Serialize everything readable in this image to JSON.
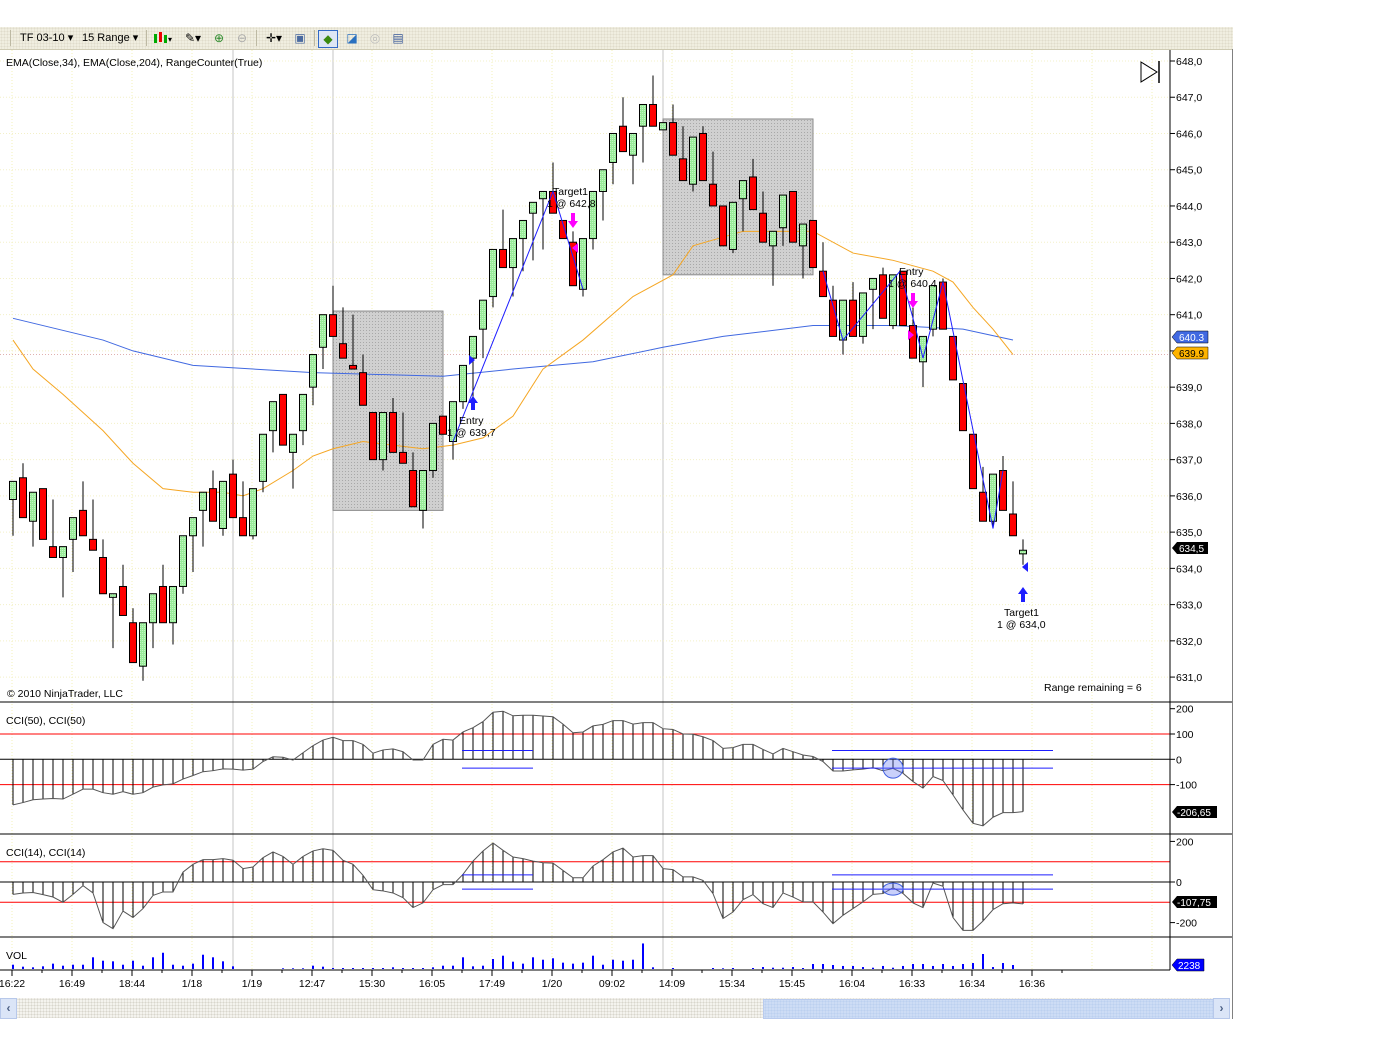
{
  "toolbar": {
    "instrument": "TF 03-10",
    "period": "15 Range",
    "icons": [
      "candlestick-style-icon",
      "pencil-draw-icon",
      "zoom-in-icon",
      "zoom-out-icon",
      "crosshair-icon",
      "properties-icon",
      "strategy-icon",
      "indicators-icon",
      "disabled-icon",
      "data-box-icon"
    ]
  },
  "chart": {
    "indicator_label": "EMA(Close,34), EMA(Close,204), RangeCounter(True)",
    "copyright": "© 2010 NinjaTrader, LLC",
    "range_remaining": "Range remaining = 6",
    "price_axis": [
      "648,0",
      "647,0",
      "646,0",
      "645,0",
      "644,0",
      "643,0",
      "642,0",
      "641,0",
      "640,0",
      "639,0",
      "638,0",
      "637,0",
      "636,0",
      "635,0",
      "634,0",
      "633,0",
      "632,0",
      "631,0"
    ],
    "last_price_tag": "634,5",
    "ema204_tag": "640.3",
    "ema34_tag": "639.9",
    "time_axis": [
      "16:22",
      "16:49",
      "18:44",
      "1/18",
      "1/19",
      "12:47",
      "15:30",
      "16:05",
      "17:49",
      "1/20",
      "09:02",
      "14:09",
      "15:34",
      "15:45",
      "16:04",
      "16:33",
      "16:34",
      "16:36"
    ],
    "annotations": {
      "entry1": [
        "Entry",
        "1 @ 639,7"
      ],
      "target1": [
        "Target1",
        "1 @ 642,8"
      ],
      "entry2": [
        "Entry",
        "1 @ 640,4"
      ],
      "target2": [
        "Target1",
        "1 @ 634,0"
      ]
    },
    "cci50_label": "CCI(50), CCI(50)",
    "cci50_axis": [
      "200",
      "100",
      "0",
      "-100"
    ],
    "cci50_tag": "-206,65",
    "cci14_label": "CCI(14), CCI(14)",
    "cci14_axis": [
      "200",
      "0",
      "-200"
    ],
    "cci14_tag": "-107,75",
    "vol_label": "VOL",
    "vol_tag": "2238"
  },
  "colors": {
    "up": "#90ee90",
    "down": "#ff0000",
    "ema34": "#f5a623",
    "ema204": "#4169e1",
    "levels": "#ff0000",
    "zigzag": "#1e1eff",
    "marker_exit": "#ff00ff",
    "volume": "#0000ff"
  },
  "chart_data": {
    "type": "bar",
    "subtype": "candlestick-ohlc",
    "ylim": [
      630.7,
      648.2
    ],
    "ohlc": [
      [
        635.9,
        636.4,
        634.9,
        636.4
      ],
      [
        636.5,
        636.9,
        635.4,
        635.4
      ],
      [
        635.3,
        636.1,
        634.6,
        636.1
      ],
      [
        636.2,
        636.2,
        634.8,
        634.8
      ],
      [
        634.6,
        635.9,
        634.3,
        634.3
      ],
      [
        634.3,
        634.6,
        633.2,
        634.6
      ],
      [
        634.8,
        635.4,
        633.9,
        635.4
      ],
      [
        635.6,
        636.4,
        634.9,
        634.9
      ],
      [
        634.8,
        635.9,
        634.5,
        634.5
      ],
      [
        634.3,
        634.8,
        633.3,
        633.3
      ],
      [
        633.2,
        633.3,
        631.8,
        633.3
      ],
      [
        633.5,
        634.1,
        632.7,
        632.7
      ],
      [
        632.5,
        632.9,
        631.4,
        631.4
      ],
      [
        631.3,
        632.5,
        630.9,
        632.5
      ],
      [
        632.5,
        633.3,
        631.8,
        633.3
      ],
      [
        633.5,
        634.1,
        632.5,
        632.5
      ],
      [
        632.5,
        633.5,
        631.9,
        633.5
      ],
      [
        633.5,
        634.9,
        633.3,
        634.9
      ],
      [
        634.9,
        635.4,
        633.9,
        635.4
      ],
      [
        635.6,
        636.1,
        634.6,
        636.1
      ],
      [
        636.2,
        636.7,
        635.3,
        635.3
      ],
      [
        635.1,
        636.4,
        634.9,
        636.4
      ],
      [
        636.6,
        637.0,
        635.4,
        635.4
      ],
      [
        635.4,
        636.4,
        634.9,
        634.9
      ],
      [
        634.9,
        636.2,
        634.8,
        636.2
      ],
      [
        636.4,
        637.7,
        636.1,
        637.7
      ],
      [
        637.8,
        638.6,
        637.2,
        638.6
      ],
      [
        638.8,
        638.8,
        637.4,
        637.4
      ],
      [
        637.2,
        637.7,
        636.2,
        637.7
      ],
      [
        637.8,
        638.8,
        637.4,
        638.8
      ],
      [
        639.0,
        639.9,
        638.5,
        639.9
      ],
      [
        640.1,
        641.0,
        639.5,
        641.0
      ],
      [
        641.0,
        641.8,
        640.4,
        640.4
      ],
      [
        640.2,
        641.2,
        639.8,
        639.8
      ],
      [
        639.6,
        641.0,
        639.5,
        639.5
      ],
      [
        639.4,
        639.9,
        638.5,
        638.5
      ],
      [
        638.3,
        638.3,
        637.0,
        637.0
      ],
      [
        637.0,
        638.3,
        636.7,
        638.3
      ],
      [
        638.3,
        638.7,
        637.2,
        637.2
      ],
      [
        637.2,
        638.3,
        636.9,
        636.9
      ],
      [
        636.7,
        637.2,
        635.7,
        635.7
      ],
      [
        635.6,
        636.7,
        635.1,
        636.7
      ],
      [
        636.7,
        638.0,
        636.5,
        638.0
      ],
      [
        638.2,
        638.2,
        637.7,
        637.7
      ],
      [
        637.5,
        638.6,
        637.0,
        638.6
      ],
      [
        638.6,
        639.6,
        638.4,
        639.6
      ],
      [
        639.8,
        640.4,
        638.6,
        640.4
      ],
      [
        640.6,
        641.4,
        639.8,
        641.4
      ],
      [
        641.5,
        642.8,
        641.2,
        642.8
      ],
      [
        642.8,
        643.9,
        642.3,
        642.3
      ],
      [
        642.3,
        643.1,
        641.5,
        643.1
      ],
      [
        643.1,
        643.6,
        642.2,
        643.6
      ],
      [
        643.8,
        644.1,
        642.5,
        644.1
      ],
      [
        644.2,
        644.4,
        642.8,
        644.4
      ],
      [
        644.4,
        645.2,
        643.8,
        643.8
      ],
      [
        643.6,
        643.6,
        643.1,
        643.1
      ],
      [
        643.0,
        643.3,
        641.8,
        641.8
      ],
      [
        641.7,
        643.1,
        641.5,
        643.1
      ],
      [
        643.1,
        644.4,
        642.8,
        644.4
      ],
      [
        644.4,
        645.0,
        643.6,
        645.0
      ],
      [
        645.2,
        646.0,
        644.6,
        646.0
      ],
      [
        646.2,
        647.0,
        645.5,
        645.5
      ],
      [
        645.4,
        646.0,
        644.6,
        646.0
      ],
      [
        646.2,
        646.8,
        645.2,
        646.8
      ],
      [
        646.8,
        647.6,
        646.2,
        646.2
      ],
      [
        646.1,
        646.3,
        646.1,
        646.3
      ],
      [
        646.3,
        646.8,
        645.4,
        645.4
      ],
      [
        645.3,
        646.2,
        644.7,
        644.7
      ],
      [
        644.6,
        645.9,
        644.4,
        645.9
      ],
      [
        646.0,
        646.2,
        644.7,
        644.7
      ],
      [
        644.6,
        645.5,
        644.0,
        644.0
      ],
      [
        644.0,
        644.0,
        642.9,
        642.9
      ],
      [
        642.8,
        644.1,
        642.7,
        644.1
      ],
      [
        644.2,
        644.7,
        643.3,
        644.7
      ],
      [
        644.8,
        645.3,
        643.9,
        643.9
      ],
      [
        643.8,
        644.4,
        643.0,
        643.0
      ],
      [
        642.9,
        643.3,
        641.8,
        643.3
      ],
      [
        643.4,
        644.3,
        642.9,
        644.3
      ],
      [
        644.4,
        644.4,
        643.0,
        643.0
      ],
      [
        642.9,
        643.5,
        642.0,
        643.5
      ],
      [
        643.6,
        643.6,
        642.3,
        642.3
      ],
      [
        642.2,
        643.0,
        641.5,
        641.5
      ],
      [
        641.4,
        641.8,
        640.4,
        640.4
      ],
      [
        640.3,
        641.4,
        639.9,
        641.4
      ],
      [
        641.4,
        641.9,
        640.4,
        640.4
      ],
      [
        640.4,
        641.6,
        640.2,
        641.6
      ],
      [
        641.7,
        642.0,
        640.6,
        642.0
      ],
      [
        642.1,
        642.3,
        640.9,
        640.9
      ],
      [
        640.7,
        642.1,
        640.6,
        642.1
      ],
      [
        642.2,
        642.2,
        640.7,
        640.7
      ],
      [
        640.7,
        641.2,
        639.8,
        639.8
      ],
      [
        639.7,
        640.4,
        639.0,
        640.4
      ],
      [
        640.6,
        641.8,
        640.4,
        641.8
      ],
      [
        641.9,
        642.0,
        640.6,
        640.6
      ],
      [
        640.4,
        640.4,
        639.2,
        639.2
      ],
      [
        639.1,
        639.1,
        637.8,
        637.8
      ],
      [
        637.7,
        637.7,
        636.2,
        636.2
      ],
      [
        636.1,
        636.8,
        635.3,
        635.3
      ],
      [
        635.3,
        636.6,
        635.1,
        636.6
      ],
      [
        636.7,
        637.1,
        635.6,
        635.6
      ],
      [
        635.5,
        636.4,
        634.9,
        634.9
      ],
      [
        634.4,
        634.8,
        634.1,
        634.5
      ]
    ],
    "ema34": [
      [
        0,
        640.3
      ],
      [
        2,
        639.5
      ],
      [
        5,
        638.8
      ],
      [
        9,
        637.8
      ],
      [
        12,
        636.9
      ],
      [
        15,
        636.2
      ],
      [
        18,
        636.1
      ],
      [
        21,
        636.1
      ],
      [
        23,
        636.0
      ],
      [
        25,
        636.2
      ],
      [
        28,
        636.7
      ],
      [
        30,
        637.1
      ],
      [
        32,
        637.3
      ],
      [
        35,
        637.5
      ],
      [
        41,
        637.3
      ],
      [
        44,
        637.4
      ],
      [
        47,
        637.6
      ],
      [
        50,
        638.2
      ],
      [
        53,
        639.5
      ],
      [
        57,
        640.3
      ],
      [
        62,
        641.5
      ],
      [
        66,
        642.1
      ],
      [
        68,
        642.9
      ],
      [
        73,
        643.3
      ],
      [
        77,
        643.3
      ],
      [
        80,
        643.3
      ],
      [
        84,
        642.7
      ],
      [
        88,
        642.5
      ],
      [
        92,
        642.2
      ],
      [
        94,
        641.9
      ],
      [
        96,
        641.2
      ],
      [
        98,
        640.6
      ],
      [
        100,
        639.9
      ]
    ],
    "ema204": [
      [
        0,
        640.9
      ],
      [
        9,
        640.3
      ],
      [
        12,
        640.0
      ],
      [
        18,
        639.6
      ],
      [
        24,
        639.5
      ],
      [
        30,
        639.4
      ],
      [
        43,
        639.3
      ],
      [
        50,
        639.5
      ],
      [
        58,
        639.7
      ],
      [
        65,
        640.1
      ],
      [
        71,
        640.4
      ],
      [
        80,
        640.7
      ],
      [
        88,
        640.7
      ],
      [
        95,
        640.6
      ],
      [
        100,
        640.3
      ]
    ],
    "shaded_boxes": [
      {
        "from_bar": 32,
        "to_bar": 43,
        "high": 641.1,
        "low": 635.6
      },
      {
        "from_bar": 65,
        "to_bar": 80,
        "high": 646.4,
        "low": 642.1
      }
    ],
    "zigzag": [
      [
        [
          44,
          637.5
        ],
        [
          54,
          644.4
        ],
        [
          57,
          641.7
        ]
      ],
      [
        [
          81,
          642.2
        ],
        [
          83,
          640.3
        ],
        [
          88.7,
          642.2
        ],
        [
          90,
          640.9
        ],
        [
          91,
          639.8
        ],
        [
          93,
          641.9
        ],
        [
          98,
          635.1
        ],
        [
          99,
          636.7
        ]
      ]
    ],
    "cci50": [
      -180,
      -171,
      -160,
      -157,
      -155,
      -157,
      -138,
      -118,
      -118,
      -132,
      -138,
      -128,
      -138,
      -132,
      -110,
      -101,
      -97,
      -78,
      -64,
      -49,
      -45,
      -38,
      -39,
      -43,
      -39,
      -9,
      10,
      8,
      -3,
      26,
      54,
      76,
      87,
      74,
      74,
      59,
      24,
      37,
      41,
      30,
      -3,
      -3,
      59,
      79,
      76,
      108,
      125,
      149,
      186,
      190,
      172,
      174,
      174,
      171,
      168,
      139,
      105,
      108,
      132,
      138,
      153,
      153,
      139,
      145,
      145,
      121,
      118,
      100,
      99,
      89,
      74,
      43,
      46,
      59,
      59,
      39,
      21,
      43,
      30,
      17,
      11,
      -9,
      -46,
      -46,
      -42,
      -39,
      -33,
      -45,
      -36,
      -55,
      -88,
      -114,
      -68,
      -84,
      -141,
      -200,
      -253,
      -263,
      -229,
      -211,
      -211,
      -207
    ],
    "cci50_levels": {
      "upper": 100,
      "lower": -100,
      "band": [
        35,
        -35
      ]
    },
    "cci14": [
      -61,
      -54,
      -52,
      -62,
      -74,
      -100,
      -61,
      -18,
      -54,
      -200,
      -230,
      -143,
      -175,
      -131,
      -66,
      -49,
      -49,
      49,
      87,
      110,
      110,
      115,
      107,
      66,
      74,
      120,
      148,
      126,
      87,
      126,
      153,
      164,
      156,
      107,
      87,
      33,
      -38,
      -44,
      -54,
      -77,
      -126,
      -103,
      -38,
      -13,
      -13,
      38,
      103,
      153,
      192,
      156,
      123,
      115,
      103,
      95,
      93,
      57,
      21,
      21,
      79,
      110,
      148,
      167,
      123,
      130,
      130,
      66,
      61,
      25,
      25,
      8,
      -57,
      -180,
      -148,
      -87,
      -62,
      -107,
      -126,
      -54,
      -74,
      -98,
      -98,
      -148,
      -205,
      -164,
      -131,
      -98,
      -61,
      -57,
      -28,
      -57,
      -103,
      -126,
      -5,
      -21,
      -175,
      -238,
      -238,
      -192,
      -136,
      -107,
      -103,
      -108
    ],
    "cci14_levels": {
      "upper": 100,
      "lower": -100,
      "band": [
        35,
        -35
      ]
    },
    "volume": [
      2400,
      1300,
      950,
      1500,
      3000,
      1850,
      2400,
      2400,
      6550,
      4650,
      4300,
      2400,
      4650,
      1850,
      6550,
      9100,
      2400,
      1850,
      3000,
      8000,
      6550,
      4300,
      1500,
      0,
      0,
      0,
      0,
      400,
      400,
      400,
      1850,
      1300,
      560,
      560,
      560,
      560,
      560,
      560,
      950,
      560,
      560,
      560,
      950,
      1850,
      1850,
      6550,
      1500,
      1850,
      5600,
      7450,
      4100,
      3000,
      6550,
      5200,
      6000,
      3550,
      3000,
      3550,
      7450,
      2400,
      5200,
      4650,
      5200,
      14300,
      950,
      0,
      560,
      0,
      0,
      0,
      560,
      400,
      560,
      0,
      560,
      1100,
      730,
      730,
      1100,
      560,
      2800,
      2800,
      2238,
      1700,
      1700,
      1100,
      730,
      1700,
      730,
      1700,
      2800,
      2800,
      1700,
      2800,
      1700,
      2800,
      3350,
      8400,
      1100,
      3350,
      2238
    ]
  }
}
